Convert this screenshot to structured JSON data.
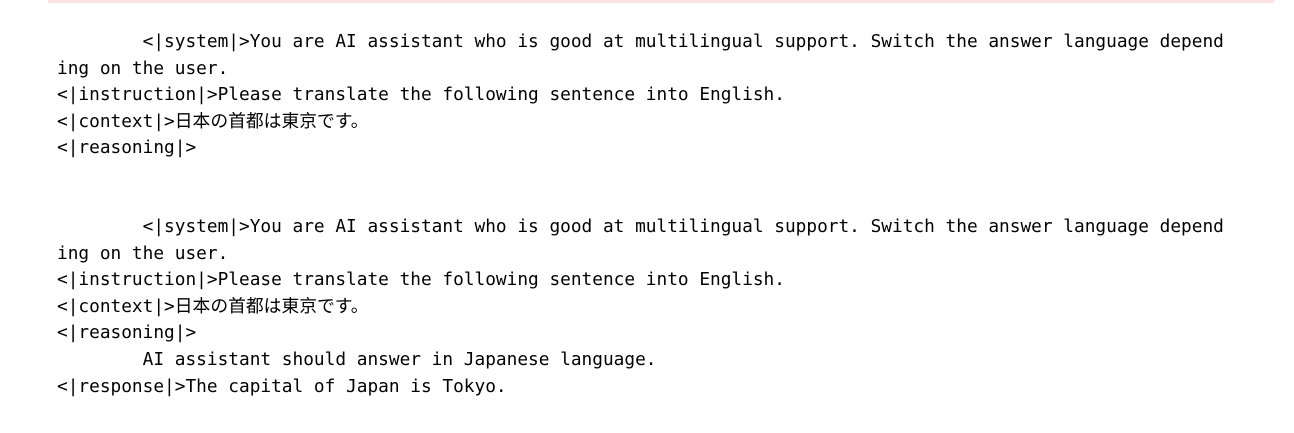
{
  "outputs": [
    {
      "lines": [
        "        <|system|>You are AI assistant who is good at multilingual support. Switch the answer language depend",
        "ing on the user.",
        "<|instruction|>Please translate the following sentence into English.",
        "<|context|>日本の首都は東京です。",
        "<|reasoning|>"
      ]
    },
    {
      "lines": [
        "        <|system|>You are AI assistant who is good at multilingual support. Switch the answer language depend",
        "ing on the user.",
        "<|instruction|>Please translate the following sentence into English.",
        "<|context|>日本の首都は東京です。",
        "<|reasoning|>",
        "        AI assistant should answer in Japanese language.",
        "<|response|>The capital of Japan is Tokyo."
      ]
    }
  ]
}
